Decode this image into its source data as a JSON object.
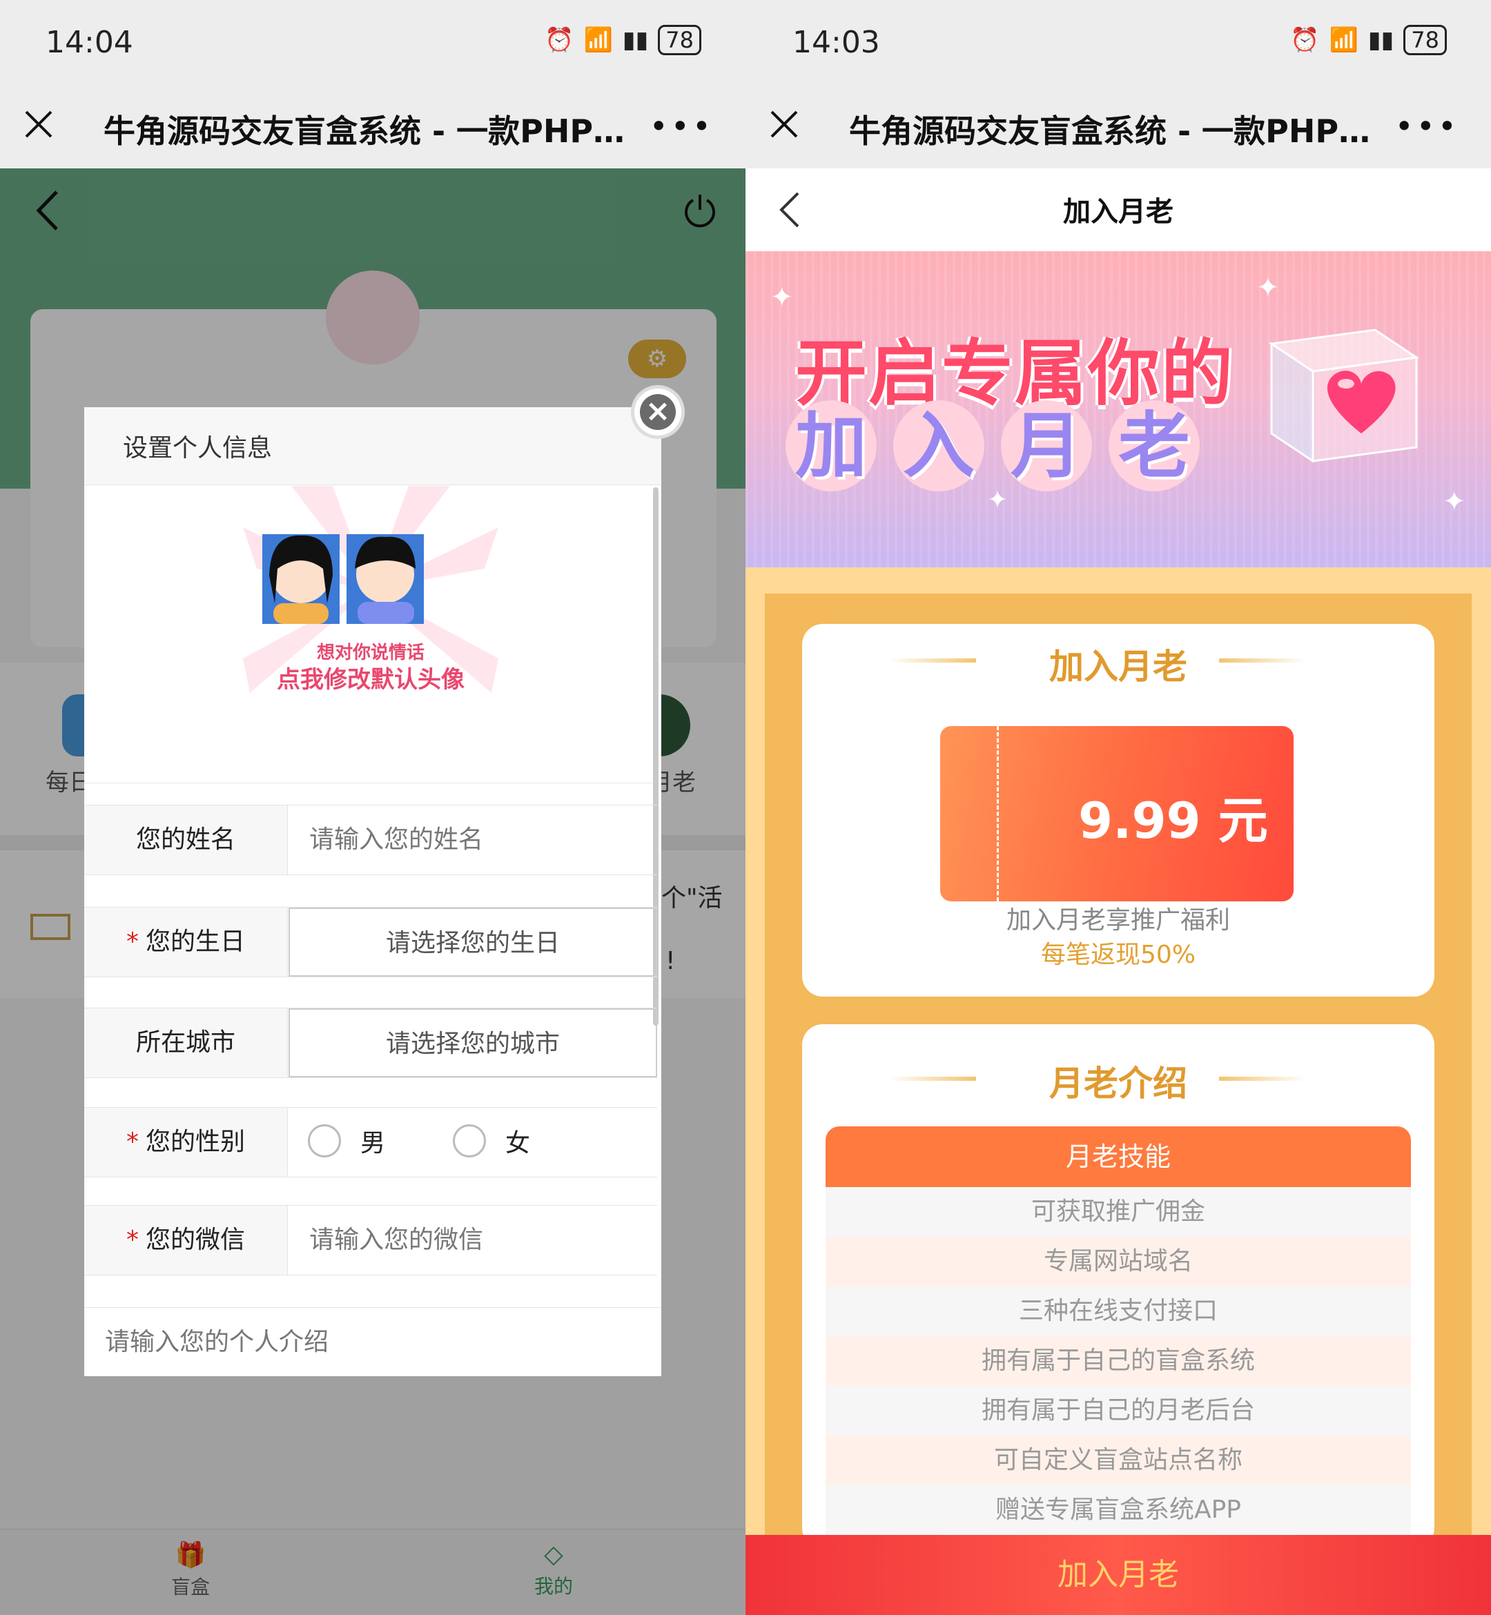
{
  "left": {
    "status": {
      "time": "14:04",
      "battery": "78"
    },
    "wechat": {
      "title": "牛角源码交友盲盒系统 - 一款PHP开…",
      "more": "•••"
    },
    "background": {
      "menu_left": "每日",
      "menu_right": "月老",
      "notice_text_1": "个\"活",
      "notice_text_2": "!"
    },
    "modal": {
      "title": "设置个人信息",
      "avatar_caption_1": "想对你说情话",
      "avatar_caption_2": "点我修改默认头像",
      "fields": {
        "name": {
          "label": "您的姓名",
          "placeholder": "请输入您的姓名"
        },
        "birthday": {
          "label": "您的生日",
          "value": "请选择您的生日"
        },
        "city": {
          "label": "所在城市",
          "value": "请选择您的城市"
        },
        "gender": {
          "label": "您的性别",
          "male": "男",
          "female": "女"
        },
        "wechat": {
          "label": "您的微信",
          "placeholder": "请输入您的微信"
        },
        "intro": {
          "placeholder": "请输入您的个人介绍"
        }
      },
      "required_mark": "*"
    },
    "tabbar": {
      "blindbox": "盲盒",
      "mine": "我的"
    }
  },
  "right": {
    "status": {
      "time": "14:03",
      "battery": "78"
    },
    "wechat": {
      "title": "牛角源码交友盲盒系统 - 一款PHP开…",
      "more": "•••"
    },
    "header": {
      "title": "加入月老"
    },
    "banner": {
      "line1": "开启专属你的",
      "line2": [
        "加",
        "入",
        "月",
        "老"
      ]
    },
    "join_card": {
      "title": "加入月老",
      "price": "9.99 元",
      "benefit_line1": "加入月老享推广福利",
      "benefit_line2": "每笔返现50%"
    },
    "intro_card": {
      "title": "月老介绍",
      "skills_header": "月老技能",
      "skills": [
        "可获取推广佣金",
        "专属网站域名",
        "三种在线支付接口",
        "拥有属于自己的盲盒系统",
        "拥有属于自己的月老后台",
        "可自定义盲盒站点名称",
        "赠送专属盲盒系统APP"
      ]
    },
    "cta": "加入月老"
  },
  "colors": {
    "green": "#6db08a",
    "orange": "#ff7a3e",
    "gold": "#e09a2e",
    "red": "#f0333a"
  }
}
